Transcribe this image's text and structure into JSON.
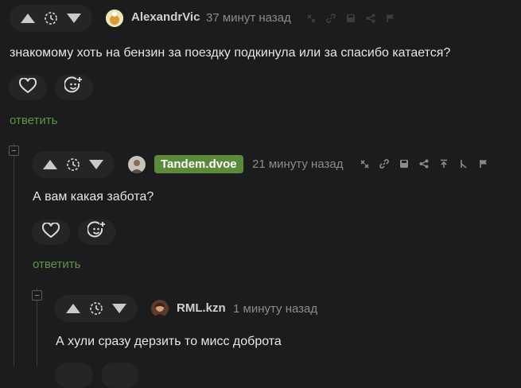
{
  "comments": [
    {
      "author": "AlexandrVic",
      "time": "37 минут назад",
      "text": "знакомому хоть на бензин за поездку подкинула или за спасибо катается?",
      "reply_label": "ответить"
    },
    {
      "author": "Tandem.dvoe",
      "time": "21 минуту назад",
      "text": "А вам какая забота?",
      "reply_label": "ответить"
    },
    {
      "author": "RML.kzn",
      "time": "1 минуту назад",
      "text": "А хули сразу дерзить то мисс доброта"
    }
  ],
  "colors": {
    "background": "#1c1c1e",
    "pill": "#252527",
    "reply": "#5f9640",
    "author_badge": "#5b8a3a"
  },
  "icons": [
    "arrow-up-icon",
    "timer-icon",
    "arrow-down-icon",
    "heart-icon",
    "smiley-add-icon",
    "branch-icon",
    "link-icon",
    "save-icon",
    "share-icon",
    "pin-top-icon",
    "edit-icon",
    "flag-icon"
  ]
}
